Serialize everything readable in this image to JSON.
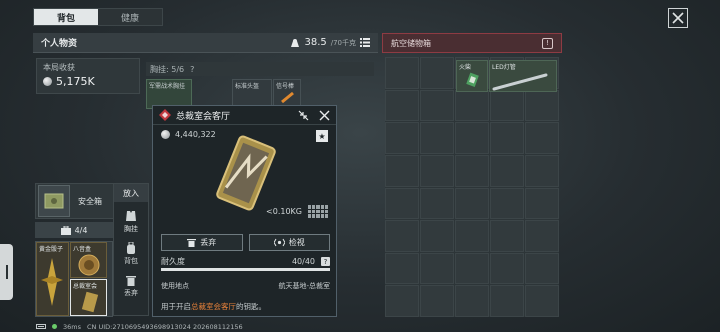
{
  "tabs": [
    {
      "label": "背包",
      "active": true
    },
    {
      "label": "健康",
      "active": false
    }
  ],
  "personal": {
    "title": "个人物资",
    "capacity_value": "38.5",
    "capacity_max": "/70千克"
  },
  "earnings": {
    "label": "本局收获",
    "value": "5,175K"
  },
  "chest_rig": {
    "label": "胸挂: 5/6",
    "help": "?"
  },
  "chest_slots": [
    {
      "label": "军需战术胸挂"
    },
    {
      "label": "标准头盔"
    },
    {
      "label": "信号棒"
    }
  ],
  "storage": {
    "title": "航空储物箱",
    "info": "!"
  },
  "storage_items": [
    {
      "label": "火柴"
    },
    {
      "label": "LED灯管"
    }
  ],
  "safe_box": {
    "label": "安全箱"
  },
  "safe_capacity": "4/4",
  "bottom_items": [
    {
      "label": "黄金骰子"
    },
    {
      "label": "八音盒"
    },
    {
      "label": "总裁室会"
    }
  ],
  "context_menu": {
    "header": "放入",
    "items": [
      {
        "label": "胸挂",
        "icon": "vest-icon"
      },
      {
        "label": "背包",
        "icon": "backpack-icon"
      },
      {
        "label": "丢弃",
        "icon": "trash-icon"
      }
    ]
  },
  "popup": {
    "title": "总裁室会客厅",
    "price": "4,440,322",
    "star": "★",
    "weight": "<0.10KG",
    "discard_label": "丢弃",
    "inspect_label": "检视",
    "durability_label": "耐久度",
    "durability_value": "40/40",
    "durability_fraction": 1.0,
    "help": "?",
    "location_label": "使用地点",
    "location_value": "航天基地-总裁室",
    "desc_prefix": "用于开启",
    "desc_highlight": "总裁室会客厅",
    "desc_suffix": "的钥匙。",
    "accent_color": "#e8823a"
  },
  "status_bar": {
    "ping": "36ms",
    "uid": "CN UID:2710695493698913024 202608112156"
  }
}
